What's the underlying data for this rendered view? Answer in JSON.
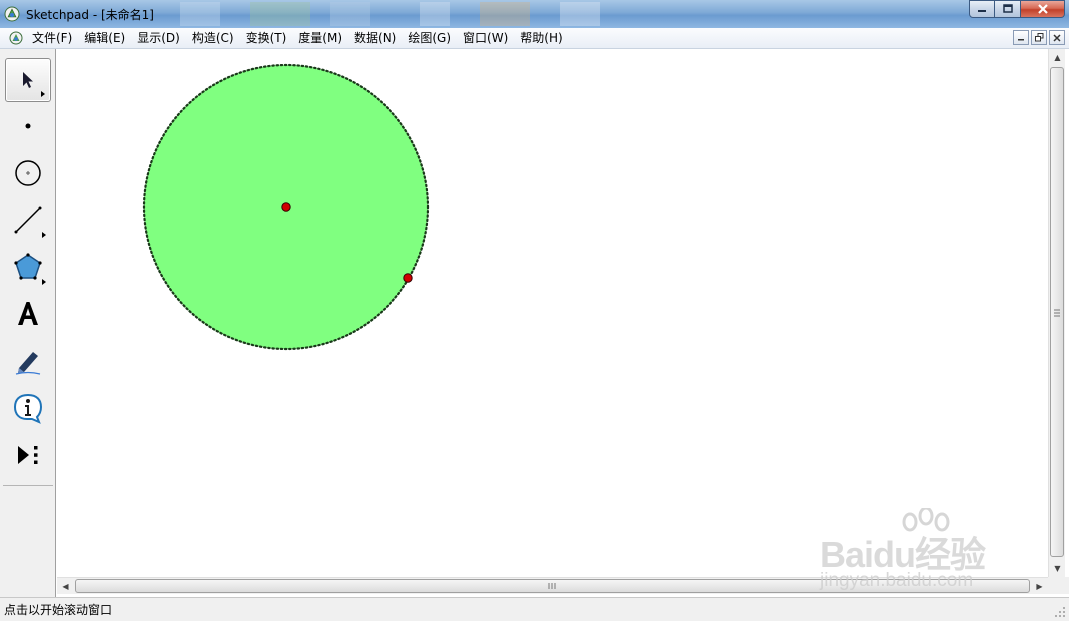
{
  "window": {
    "title": "Sketchpad  - [未命名1]"
  },
  "menu": {
    "items": [
      {
        "label": "文件(F)"
      },
      {
        "label": "编辑(E)"
      },
      {
        "label": "显示(D)"
      },
      {
        "label": "构造(C)"
      },
      {
        "label": "变换(T)"
      },
      {
        "label": "度量(M)"
      },
      {
        "label": "数据(N)"
      },
      {
        "label": "绘图(G)"
      },
      {
        "label": "窗口(W)"
      },
      {
        "label": "帮助(H)"
      }
    ]
  },
  "toolbox": {
    "selected_tool": "arrow-tool",
    "tools": [
      "arrow-tool",
      "point-tool",
      "compass-tool",
      "straightedge-tool",
      "polygon-tool",
      "text-tool",
      "marker-tool",
      "information-tool",
      "custom-tool"
    ]
  },
  "canvas": {
    "circle_fill": "#80ff80",
    "circle_stroke": "#1a3a1a",
    "point_color": "#d00000"
  },
  "statusbar": {
    "text": "点击以开始滚动窗口"
  },
  "watermark": {
    "brand": "Baidu经验",
    "url": "jingyan.baidu.com"
  }
}
